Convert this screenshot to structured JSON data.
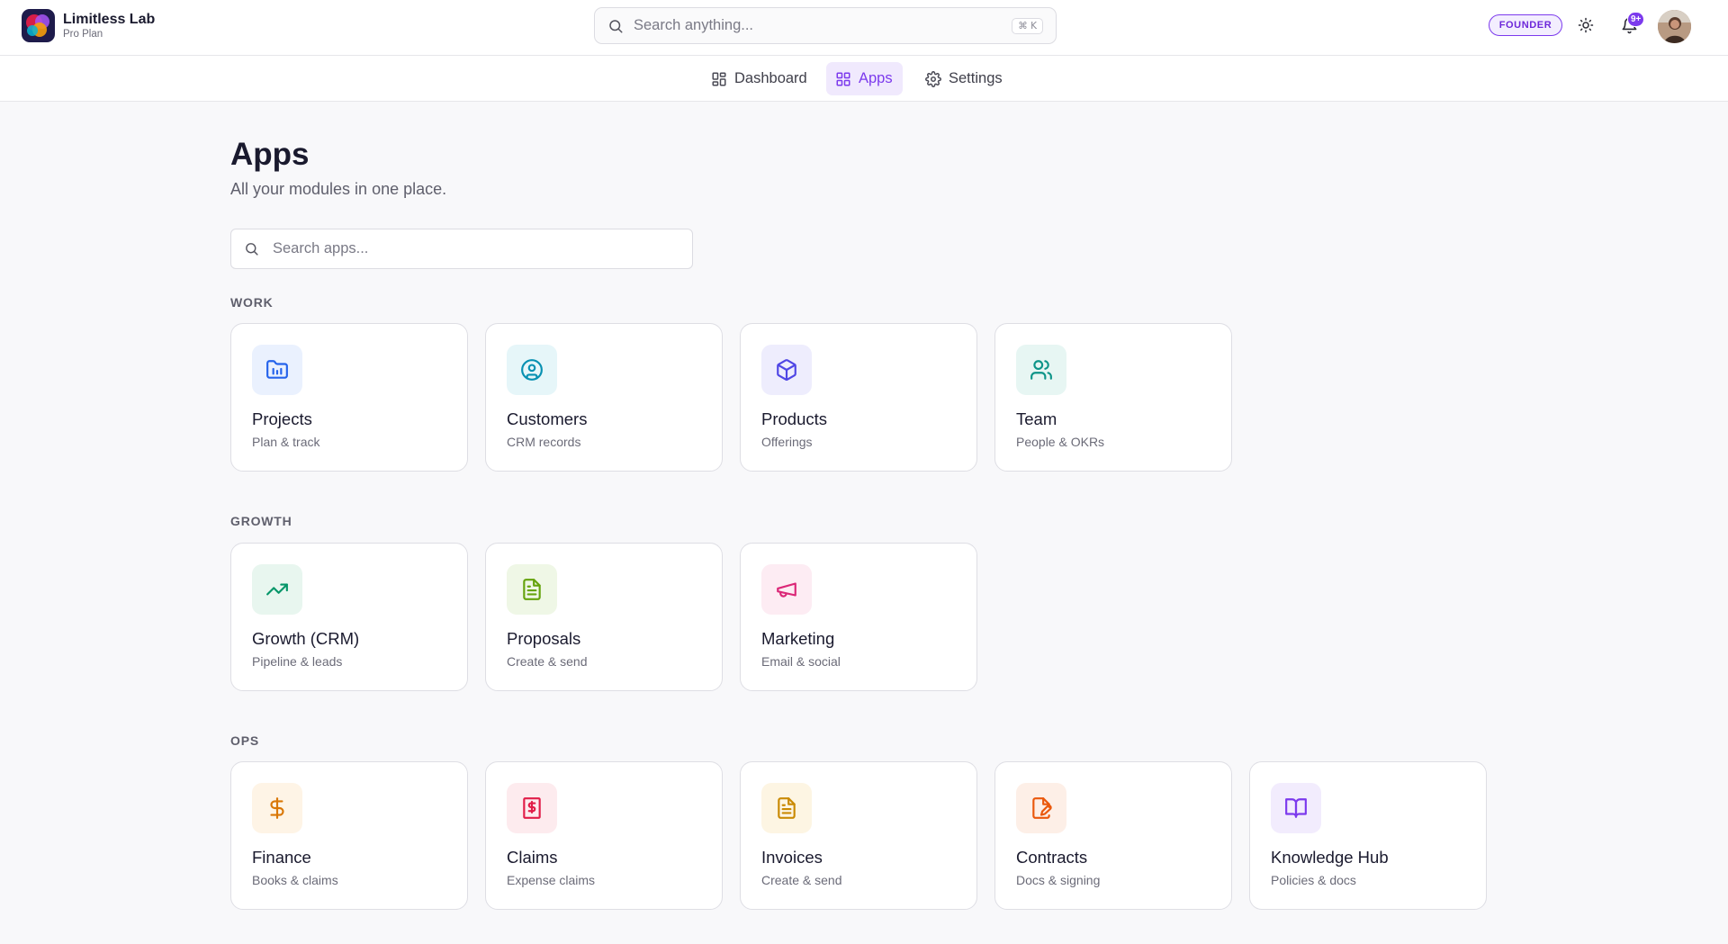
{
  "brand": {
    "name": "Limitless Lab",
    "plan": "Pro Plan"
  },
  "header": {
    "search_placeholder": "Search anything...",
    "search_shortcut": "⌘ K",
    "role_badge": "FOUNDER",
    "notification_count": "9+"
  },
  "nav": {
    "tabs": [
      {
        "label": "Dashboard",
        "icon": "layout-grid-icon",
        "active": false
      },
      {
        "label": "Apps",
        "icon": "apps-grid-icon",
        "active": true
      },
      {
        "label": "Settings",
        "icon": "gear-icon",
        "active": false
      }
    ]
  },
  "main": {
    "title": "Apps",
    "subtitle": "All your modules in one place.",
    "search_placeholder": "Search apps..."
  },
  "sections": [
    {
      "label": "WORK",
      "apps": [
        {
          "title": "Projects",
          "desc": "Plan & track",
          "icon": "folder-chart-icon",
          "color": "#2563eb",
          "bg": "#eaf1fe"
        },
        {
          "title": "Customers",
          "desc": "CRM records",
          "icon": "user-circle-icon",
          "color": "#0891b2",
          "bg": "#e6f6f9"
        },
        {
          "title": "Products",
          "desc": "Offerings",
          "icon": "box-icon",
          "color": "#4f46e5",
          "bg": "#eeedfd"
        },
        {
          "title": "Team",
          "desc": "People & OKRs",
          "icon": "users-icon",
          "color": "#0d9488",
          "bg": "#e7f6f3"
        }
      ]
    },
    {
      "label": "GROWTH",
      "apps": [
        {
          "title": "Growth (CRM)",
          "desc": "Pipeline & leads",
          "icon": "trending-up-icon",
          "color": "#059669",
          "bg": "#e8f6ef"
        },
        {
          "title": "Proposals",
          "desc": "Create & send",
          "icon": "file-text-icon",
          "color": "#65a30d",
          "bg": "#eff7e6"
        },
        {
          "title": "Marketing",
          "desc": "Email & social",
          "icon": "megaphone-icon",
          "color": "#db2777",
          "bg": "#fdecf3"
        }
      ]
    },
    {
      "label": "OPS",
      "apps": [
        {
          "title": "Finance",
          "desc": "Books & claims",
          "icon": "dollar-icon",
          "color": "#d97706",
          "bg": "#fef4e6"
        },
        {
          "title": "Claims",
          "desc": "Expense claims",
          "icon": "receipt-icon",
          "color": "#e11d48",
          "bg": "#fdebee"
        },
        {
          "title": "Invoices",
          "desc": "Create & send",
          "icon": "invoice-icon",
          "color": "#ca8a04",
          "bg": "#fdf5e3"
        },
        {
          "title": "Contracts",
          "desc": "Docs & signing",
          "icon": "file-signature-icon",
          "color": "#ea580c",
          "bg": "#fdefe7"
        },
        {
          "title": "Knowledge Hub",
          "desc": "Policies & docs",
          "icon": "book-open-icon",
          "color": "#7c3aed",
          "bg": "#f2ecfd"
        }
      ]
    }
  ]
}
